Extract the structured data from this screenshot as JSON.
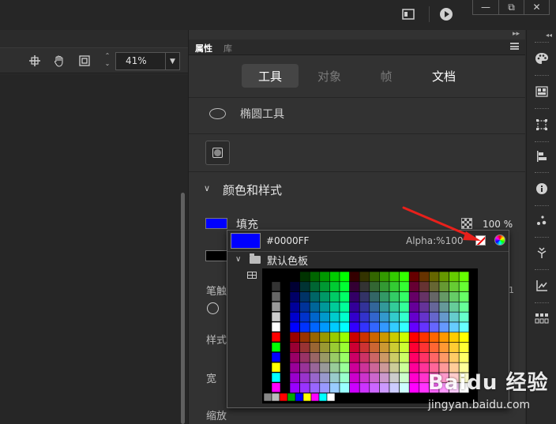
{
  "window": {
    "minimize": "—",
    "restore": "⧉",
    "close": "✕"
  },
  "toolbar": {
    "zoom_value": "41%"
  },
  "props_panel": {
    "tab_properties": "属性",
    "tab_library": "库",
    "tabs": [
      {
        "label": "工具"
      },
      {
        "label": "对象"
      },
      {
        "label": "帧"
      },
      {
        "label": "文档"
      }
    ],
    "tool_name": "椭圆工具",
    "section_title": "颜色和样式",
    "fill_label": "填充",
    "fill_color": "#0000ff",
    "fill_alpha": "100 %",
    "stroke_color": "#000000",
    "stroke_label": "笔触",
    "style_label": "样式",
    "width_label": "宽",
    "scale_label": "缩放",
    "stray_text": "1"
  },
  "color_popup": {
    "current_color": "#0000FF",
    "alpha_label": "Alpha:%",
    "alpha_value": "100",
    "folder_label": "默认色板"
  },
  "icons": {
    "titlebar": [
      "layout-icon",
      "play-icon"
    ],
    "left_toolbar": [
      "crosshair-icon",
      "hand-icon",
      "fit-frame-icon"
    ],
    "dock": [
      "palette-icon",
      "library-icon",
      "transform-icon",
      "align-icon",
      "info-icon",
      "motion-icon",
      "assets-icon",
      "graph-icon",
      "components-icon"
    ]
  },
  "watermark": {
    "brand": "Baidu 经验",
    "url": "jingyan.baidu.com"
  }
}
